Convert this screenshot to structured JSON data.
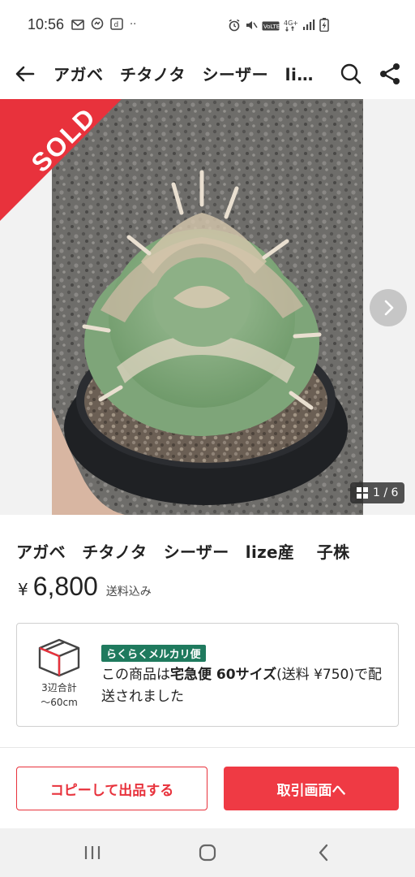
{
  "status_bar": {
    "time": "10:56",
    "left_icons": [
      "mail-icon",
      "messenger-icon",
      "docomo-icon",
      "more-dots-icon"
    ],
    "right_icons": [
      "alarm-icon",
      "mute-icon",
      "volte-icon",
      "4g-icon",
      "signal-icon",
      "battery-charging-icon"
    ],
    "dots": "··",
    "volte_label": "VoLTE",
    "network_label": "4G+"
  },
  "header": {
    "title": "アガベ　チタノタ　シーザー　lize産　子株",
    "back_icon": "arrow-left-icon",
    "search_icon": "search-icon",
    "share_icon": "share-icon"
  },
  "carousel": {
    "sold_label": "SOLD",
    "counter": "1 / 6",
    "current": 1,
    "total": 6,
    "ribbon_color": "#e8323c"
  },
  "item": {
    "title": "アガベ　チタノタ　シーザー　lize産　 子株",
    "currency": "¥",
    "price": "6,800",
    "shipping_included": "送料込み"
  },
  "shipping": {
    "size_caption_line1": "3辺合計",
    "size_caption_line2": "〜60cm",
    "method_badge": "らくらくメルカリ便",
    "text_prefix": "この商品は",
    "text_bold": "宅急便 60サイズ",
    "text_suffix": "(送料 ¥750)で配送されました",
    "badge_color": "#1f7a5e"
  },
  "actions": {
    "copy_listing": "コピーして出品する",
    "go_to_transaction": "取引画面へ",
    "accent_color": "#e8323c"
  },
  "nav": {
    "recents_icon": "recents-icon",
    "home_icon": "home-icon",
    "back_icon": "back-chevron-icon"
  }
}
